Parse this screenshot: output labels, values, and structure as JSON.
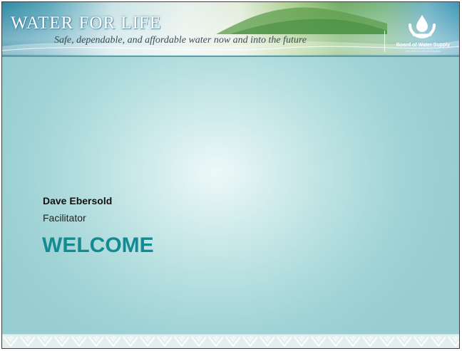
{
  "header": {
    "title": "WATER FOR LIFE",
    "tagline": "Safe, dependable, and affordable water now and into the future",
    "logo": {
      "name": "Board of Water Supply",
      "subtitle": "City and County of Honolulu"
    }
  },
  "content": {
    "presenter_name": "Dave Ebersold",
    "presenter_role": "Facilitator",
    "heading": "WELCOME"
  },
  "colors": {
    "heading": "#148a92",
    "background_center": "#eef8f8",
    "background_edge": "#98ced1",
    "banner_left": "#2f8aa6",
    "banner_right": "#3f98b8"
  },
  "icons": [
    "water-drop-logo-icon",
    "tribal-pattern-footer"
  ]
}
